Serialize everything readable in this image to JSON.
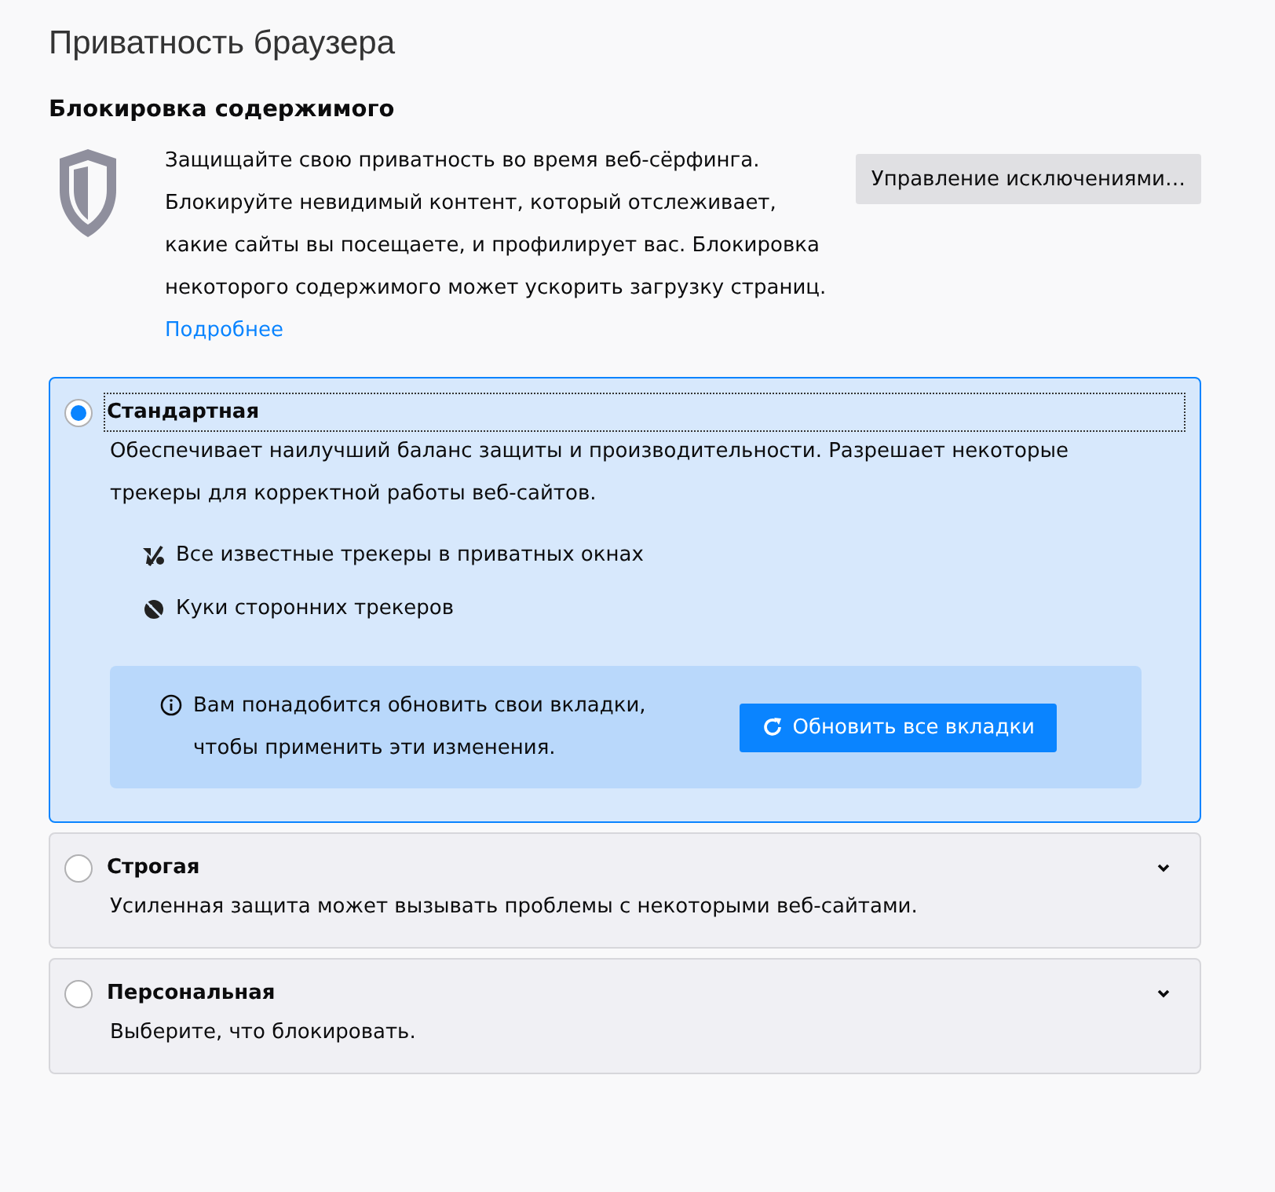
{
  "page_title": "Приватность браузера",
  "section": {
    "heading": "Блокировка содержимого",
    "description": "Защищайте свою приватность во время веб-сёрфинга. Блокируйте невидимый контент, который отслеживает, какие сайты вы посещаете, и профилирует вас. Блокировка некоторого содержимого может ускорить загрузку страниц.",
    "learn_more": "Подробнее",
    "exceptions_button": "Управление исключениями…"
  },
  "options": [
    {
      "title": "Стандартная",
      "selected": true,
      "expanded": true,
      "description": "Обеспечивает наилучший баланс защиты и производительности. Разрешает некоторые трекеры для корректной работы веб-сайтов.",
      "items": [
        {
          "kind": "trackers",
          "label": "Все известные трекеры в приватных окнах"
        },
        {
          "kind": "cookies",
          "label": "Куки сторонних трекеров"
        }
      ],
      "notice": {
        "text": "Вам понадобится обновить свои вкладки, чтобы применить эти изменения.",
        "button": "Обновить все вкладки"
      }
    },
    {
      "title": "Строгая",
      "selected": false,
      "expanded": false,
      "description": "Усиленная защита может вызывать проблемы с некоторыми веб-сайтами."
    },
    {
      "title": "Персональная",
      "selected": false,
      "expanded": false,
      "description": "Выберите, что блокировать."
    }
  ]
}
